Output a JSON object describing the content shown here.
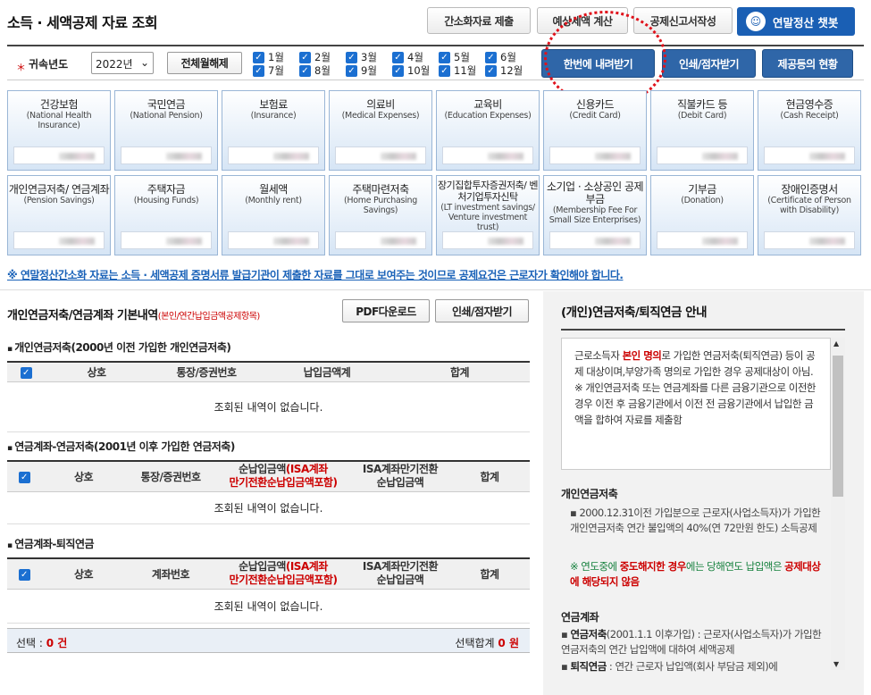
{
  "page_title": "소득 · 세액공제 자료 조회",
  "top_buttons": [
    "간소화자료 제출",
    "예상세액 계산",
    "공제신고서작성"
  ],
  "chatbot": {
    "label": "연말정산 챗봇",
    "icon": "chatbot-icon"
  },
  "filter": {
    "label": "귀속년도",
    "year": "2022년",
    "clear_all": "전체월해제",
    "months_row1": [
      "1월",
      "2월",
      "3월",
      "4월",
      "5월",
      "6월"
    ],
    "months_row2": [
      "7월",
      "8월",
      "9월",
      "10월",
      "11월",
      "12월"
    ]
  },
  "action_buttons": [
    "한번에 내려받기",
    "인쇄/점자받기",
    "제공등의 현황"
  ],
  "cards": [
    {
      "k": "건강보험",
      "e": "(National Health Insurance)"
    },
    {
      "k": "국민연금",
      "e": "(National Pension)"
    },
    {
      "k": "보험료",
      "e": "(Insurance)"
    },
    {
      "k": "의료비",
      "e": "(Medical Expenses)"
    },
    {
      "k": "교육비",
      "e": "(Education Expenses)"
    },
    {
      "k": "신용카드",
      "e": "(Credit Card)"
    },
    {
      "k": "직불카드 등",
      "e": "(Debit Card)"
    },
    {
      "k": "현금영수증",
      "e": "(Cash Receipt)"
    },
    {
      "k": "개인연금저축/ 연금계좌",
      "e": "(Pension Savings)"
    },
    {
      "k": "주택자금",
      "e": "(Housing Funds)"
    },
    {
      "k": "월세액",
      "e": "(Monthly rent)"
    },
    {
      "k": "주택마련저축",
      "e": "(Home Purchasing Savings)"
    },
    {
      "k": "장기집합투자증권저축/ 벤처기업투자신탁",
      "e": "(LT investment savings/ Venture investment trust)"
    },
    {
      "k": "소기업 · 소상공인 공제부금",
      "e": "(Membership Fee For Small Size Enterprises)"
    },
    {
      "k": "기부금",
      "e": "(Donation)"
    },
    {
      "k": "장애인증명서",
      "e": "(Certificate of Person with Disability)"
    }
  ],
  "notice": "※ 연말정산간소화 자료는 소득 · 세액공제 증명서류 발급기관이 제출한 자료를 그대로 보여주는 것이므로 공제요건은 근로자가 확인해야 합니다.",
  "section": {
    "title": "개인연금저축/연금계좌 기본내역",
    "title_note": "(본인/연간납입금액공제항목)",
    "pdf_button": "PDF다운로드",
    "print_button": "인쇄/점자받기"
  },
  "tables": [
    {
      "title": "개인연금저축(2000년 이전 가입한 개인연금저축)",
      "headers": [
        "상호",
        "통장/증권번호",
        "납입금액계",
        "합계"
      ],
      "empty": "조회된 내역이 없습니다."
    },
    {
      "title": "연금계좌-연금저축(2001년 이후 가입한 연금저축)",
      "headers": [
        "상호",
        "통장/증권번호",
        "순납입금액",
        "(ISA계좌",
        "만기전환순납입금액포함)",
        "ISA계좌만기전환",
        "순납입금액",
        "합계"
      ],
      "empty": "조회된 내역이 없습니다."
    },
    {
      "title": "연금계좌-퇴직연금",
      "headers": [
        "상호",
        "계좌번호",
        "순납입금액",
        "(ISA계좌",
        "만기전환순납입금액포함)",
        "ISA계좌만기전환",
        "순납입금액",
        "합계"
      ],
      "empty": "조회된 내역이 없습니다."
    }
  ],
  "summary": {
    "select_label": "선택 :",
    "select_count": "0 건",
    "total_label": "선택합계",
    "total_value": "0 원"
  },
  "guide": {
    "title": "(개인)연금저축/퇴직연금 안내",
    "box_pre": "근로소득자 ",
    "box_em": "본인 명의",
    "box_post": "로 가입한 연금저축(퇴직연금) 등이 공제 대상이며,부양가족 명의로 가입한 경우 공제대상이 아님.",
    "box_note": "※ 개인연금저축 또는 연금계좌를 다른 금융기관으로 이전한 경우 이전 후 금융기관에서 이전 전 금융기관에서 납입한 금액을 합하여 자료를 제출함",
    "h1": "개인연금저축",
    "p1": "2000.12.31이전 가입분으로 근로자(사업소득자)가 가입한 개인연금저축 연간 불입액의 40%(연 72만원 한도) 소득공제",
    "n1_pre": "※ 연도중에 ",
    "n1_em": "중도해지한 경우",
    "n1_mid": "에는 당해연도 납입액은 ",
    "n1_em2": "공제대상에 해당되지 않음",
    "h2": "연금계좌",
    "p2a_b": "연금저축",
    "p2a": "(2001.1.1 이후가입) : 근로자(사업소득자)가 가입한 연금저축의 연간 납입액에 대하여 세액공제",
    "p2b_b": "퇴직연금",
    "p2b": " : 연간 근로자 납입액(회사 부담금 제외)에"
  }
}
